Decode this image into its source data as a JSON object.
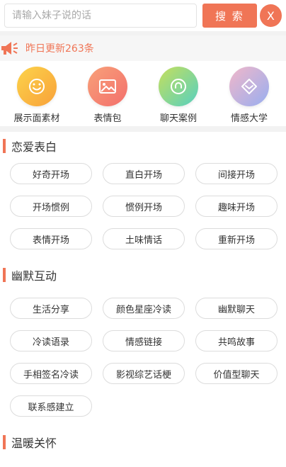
{
  "search": {
    "placeholder": "请输入妹子说的话",
    "button_label": "搜 索",
    "close_label": "X"
  },
  "notice": {
    "text": "昨日更新263条"
  },
  "categories": [
    {
      "label": "展示面素材",
      "icon": "smile-icon",
      "color_from": "#fcd34a",
      "color_to": "#f8a13a"
    },
    {
      "label": "表情包",
      "icon": "image-icon",
      "color_from": "#f8a179",
      "color_to": "#f36f6c"
    },
    {
      "label": "聊天案例",
      "icon": "chat-circle-icon",
      "color_from": "#c6df5c",
      "color_to": "#56d0c0"
    },
    {
      "label": "情感大学",
      "icon": "diamond-icon",
      "color_from": "#f1b7c9",
      "color_to": "#98aef0"
    }
  ],
  "sections": [
    {
      "title": "恋爱表白",
      "tags": [
        "好奇开场",
        "直白开场",
        "间接开场",
        "开场惯例",
        "惯例开场",
        "趣味开场",
        "表情开场",
        "土味情话",
        "重新开场"
      ]
    },
    {
      "title": "幽默互动",
      "tags": [
        "生活分享",
        "颜色星座冷读",
        "幽默聊天",
        "冷读语录",
        "情感链接",
        "共鸣故事",
        "手相签名冷读",
        "影视综艺话梗",
        "价值型聊天",
        "联系感建立"
      ]
    },
    {
      "title": "温暖关怀",
      "tags": []
    }
  ],
  "colors": {
    "accent": "#f07556"
  }
}
